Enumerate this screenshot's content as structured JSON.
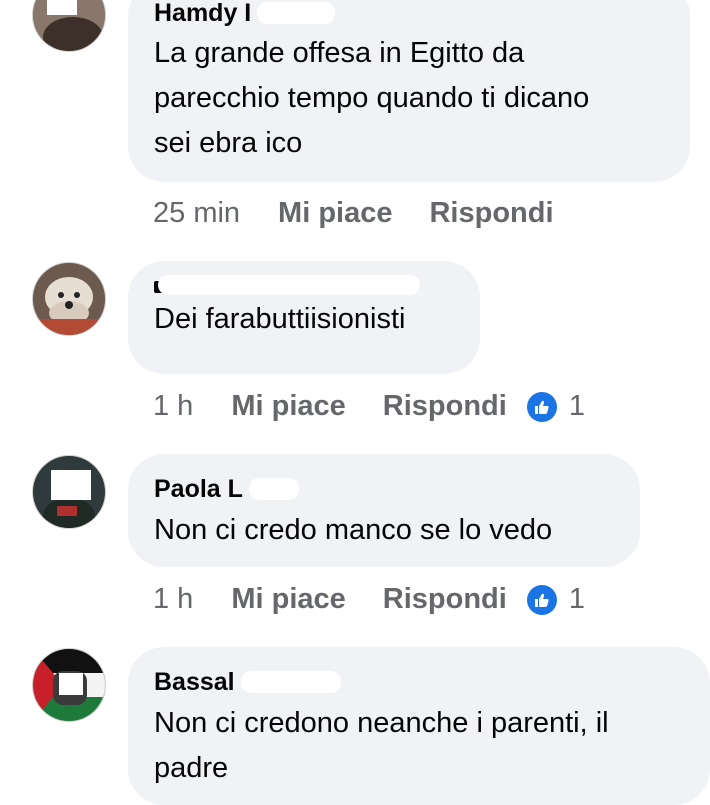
{
  "colors": {
    "bubble_bg": "#f0f2f5",
    "meta_text": "#65676b",
    "like_blue": "#1b74e4",
    "text": "#050505"
  },
  "comments": [
    {
      "author": "Hamdy I",
      "text_lines": [
        "La grande offesa in Egitto da",
        "parecchio tempo quando ti dicano",
        "sei ebra ico"
      ],
      "time": "25 min",
      "like_label": "Mi piace",
      "reply_label": "Rispondi",
      "reactions": null
    },
    {
      "author": "",
      "text_lines": [
        "Dei farabuttiisionisti"
      ],
      "time": "1 h",
      "like_label": "Mi piace",
      "reply_label": "Rispondi",
      "reactions": "1"
    },
    {
      "author": "Paola L",
      "text_lines": [
        "Non ci credo manco se lo vedo"
      ],
      "time": "1 h",
      "like_label": "Mi piace",
      "reply_label": "Rispondi",
      "reactions": "1"
    },
    {
      "author": "Bassal",
      "text_lines": [
        "Non ci credono neanche i parenti,  il",
        "padre"
      ],
      "time": "",
      "like_label": "",
      "reply_label": "",
      "reactions": null
    }
  ]
}
